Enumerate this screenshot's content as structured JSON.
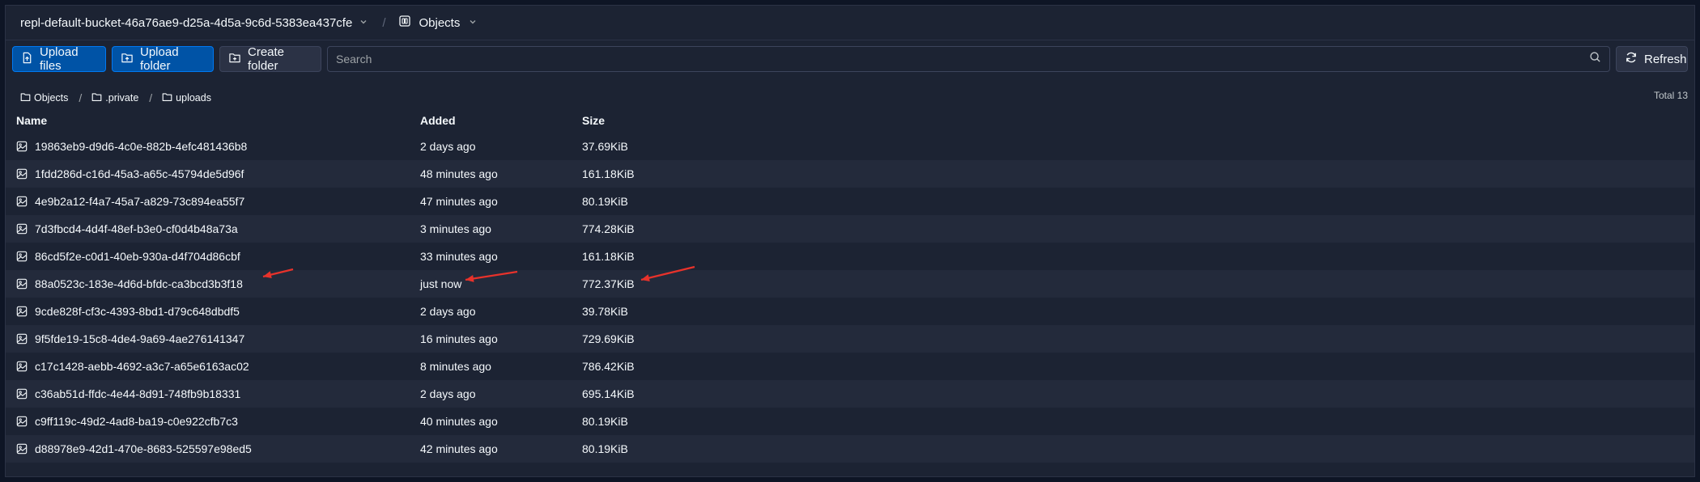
{
  "topbar": {
    "bucket_name": "repl-default-bucket-46a76ae9-d25a-4d5a-9c6d-5383ea437cfe",
    "section_label": "Objects"
  },
  "toolbar": {
    "upload_files_label": "Upload files",
    "upload_folder_label": "Upload folder",
    "create_folder_label": "Create folder",
    "search_placeholder": "Search",
    "refresh_label": "Refresh"
  },
  "breadcrumb": [
    {
      "label": "Objects"
    },
    {
      "label": ".private"
    },
    {
      "label": "uploads"
    }
  ],
  "total_label": "Total 13",
  "table": {
    "columns": [
      "Name",
      "Added",
      "Size"
    ],
    "rows": [
      {
        "name": "19863eb9-d9d6-4c0e-882b-4efc481436b8",
        "added": "2 days ago",
        "size": "37.69KiB"
      },
      {
        "name": "1fdd286d-c16d-45a3-a65c-45794de5d96f",
        "added": "48 minutes ago",
        "size": "161.18KiB"
      },
      {
        "name": "4e9b2a12-f4a7-45a7-a829-73c894ea55f7",
        "added": "47 minutes ago",
        "size": "80.19KiB"
      },
      {
        "name": "7d3fbcd4-4d4f-48ef-b3e0-cf0d4b48a73a",
        "added": "3 minutes ago",
        "size": "774.28KiB"
      },
      {
        "name": "86cd5f2e-c0d1-40eb-930a-d4f704d86cbf",
        "added": "33 minutes ago",
        "size": "161.18KiB"
      },
      {
        "name": "88a0523c-183e-4d6d-bfdc-ca3bcd3b3f18",
        "added": "just now",
        "size": "772.37KiB"
      },
      {
        "name": "9cde828f-cf3c-4393-8bd1-d79c648dbdf5",
        "added": "2 days ago",
        "size": "39.78KiB"
      },
      {
        "name": "9f5fde19-15c8-4de4-9a69-4ae276141347",
        "added": "16 minutes ago",
        "size": "729.69KiB"
      },
      {
        "name": "c17c1428-aebb-4692-a3c7-a65e6163ac02",
        "added": "8 minutes ago",
        "size": "786.42KiB"
      },
      {
        "name": "c36ab51d-ffdc-4e44-8d91-748fb9b18331",
        "added": "2 days ago",
        "size": "695.14KiB"
      },
      {
        "name": "c9ff119c-49d2-4ad8-ba19-c0e922cfb7c3",
        "added": "40 minutes ago",
        "size": "80.19KiB"
      },
      {
        "name": "d88978e9-42d1-470e-8683-525597e98ed5",
        "added": "42 minutes ago",
        "size": "80.19KiB"
      }
    ]
  },
  "annotation_color": "#e8322b",
  "icons": {
    "row": "image-file-icon",
    "breadcrumb": "folder-icon",
    "objects_tab": "bucket-objects-icon",
    "upload_files": "file-upload-icon",
    "upload_folder": "folder-upload-icon",
    "create_folder": "folder-plus-icon",
    "search": "search-icon",
    "refresh": "refresh-icon"
  }
}
